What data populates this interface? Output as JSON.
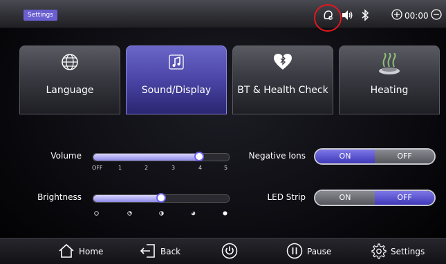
{
  "header": {
    "title": "Settings",
    "status_icons": [
      "oxygen-sensor-icon",
      "volume-icon",
      "bluetooth-icon"
    ],
    "timer": {
      "value": "00:00",
      "plus_icon": "plus-circle-icon",
      "minus_icon": "minus-circle-icon"
    },
    "highlight_color": "#e4171e"
  },
  "tabs": [
    {
      "label": "Language",
      "icon": "globe-icon",
      "active": false
    },
    {
      "label": "Sound/Display",
      "icon": "music-note-icon",
      "active": true
    },
    {
      "label": "BT & Health Check",
      "icon": "heart-bluetooth-icon",
      "active": false
    },
    {
      "label": "Heating",
      "icon": "steam-heat-icon",
      "active": false
    }
  ],
  "volume": {
    "label": "Volume",
    "ticks": [
      "OFF",
      "1",
      "2",
      "3",
      "4",
      "5"
    ],
    "level": 4,
    "max": 5
  },
  "brightness": {
    "label": "Brightness",
    "tick_icons": [
      "brightness-0-icon",
      "brightness-1-icon",
      "brightness-2-icon",
      "brightness-3-icon",
      "brightness-4-icon"
    ],
    "level": 2,
    "max": 4
  },
  "negative_ions": {
    "label": "Negative Ions",
    "on_label": "ON",
    "off_label": "OFF",
    "state": "ON"
  },
  "led_strip": {
    "label": "LED Strip",
    "on_label": "ON",
    "off_label": "OFF",
    "state": "OFF"
  },
  "bottom_nav": {
    "home": "Home",
    "back": "Back",
    "pause": "Pause",
    "settings": "Settings"
  },
  "colors": {
    "accent": "#6a5fd0",
    "toggle_active": "#4f48c8"
  }
}
